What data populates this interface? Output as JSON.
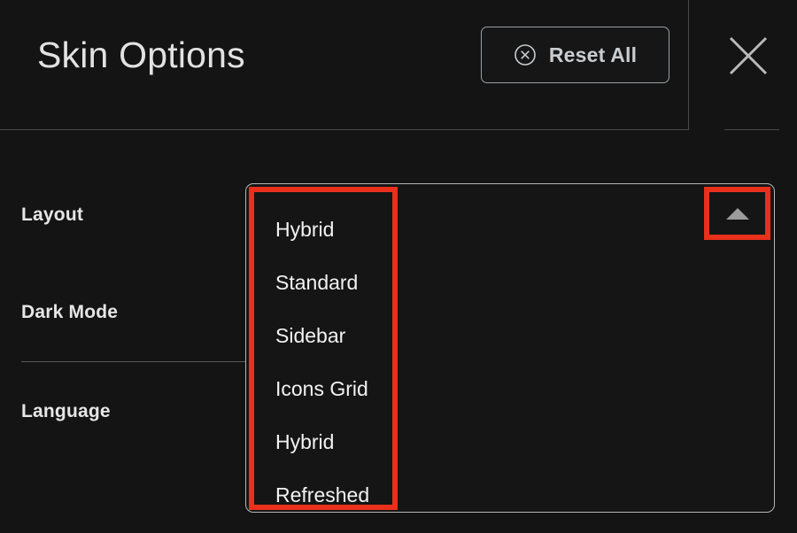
{
  "header": {
    "title": "Skin Options",
    "reset_button": {
      "label": "Reset All",
      "icon": "circle-x-icon"
    },
    "close_button": {
      "icon": "close-icon"
    }
  },
  "settings": {
    "rows": [
      {
        "label": "Layout"
      },
      {
        "label": "Dark Mode"
      },
      {
        "label": "Language"
      }
    ]
  },
  "layout_dropdown": {
    "state": "open",
    "toggle_icon": "caret-up-icon",
    "selected": "Hybrid",
    "options": [
      {
        "label": "Hybrid"
      },
      {
        "label": "Standard"
      },
      {
        "label": "Sidebar"
      },
      {
        "label": "Icons Grid"
      },
      {
        "label": "Hybrid"
      },
      {
        "label": "Refreshed"
      }
    ]
  },
  "colors": {
    "background": "#141414",
    "panel_border": "#b6b6b6",
    "highlight": "#e8301a",
    "text_primary": "#f2f2f2",
    "text_title": "#e2e2e2",
    "divider": "#4a4a4a"
  }
}
